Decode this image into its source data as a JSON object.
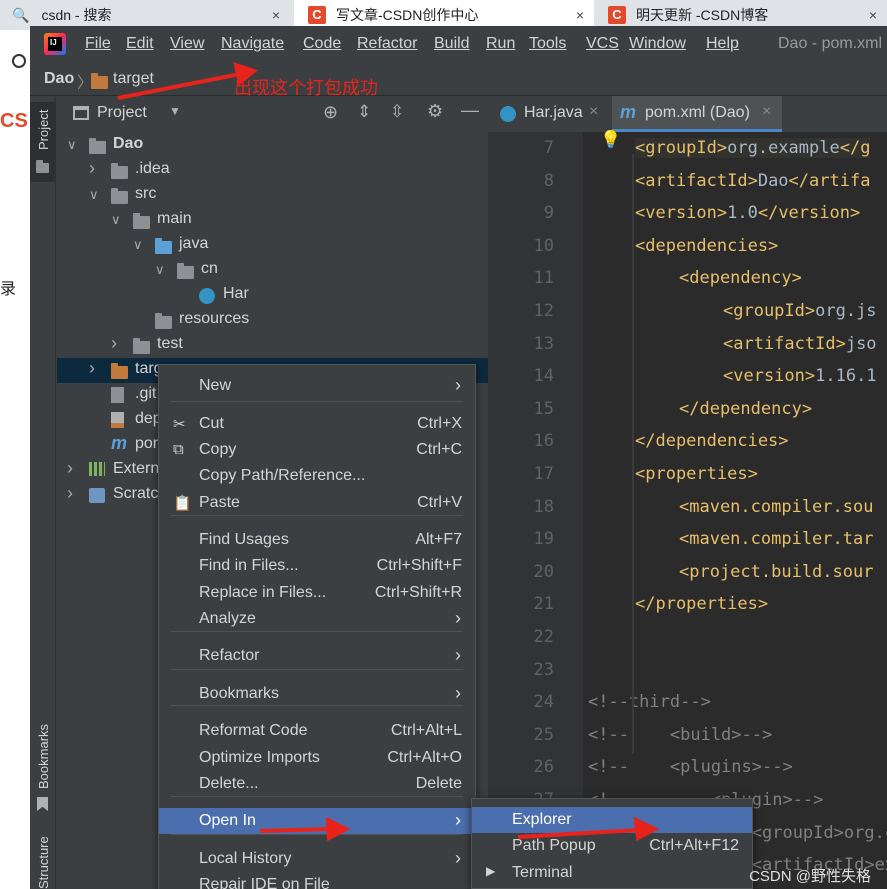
{
  "browser": {
    "tabs": [
      {
        "title": "csdn - 搜索",
        "close": "×"
      },
      {
        "title": "写文章-CSDN创作中心",
        "close": "×"
      },
      {
        "title": "明天更新 -CSDN博客",
        "close": "×"
      }
    ],
    "side_fragments": [
      "录",
      "CS"
    ]
  },
  "ide": {
    "menu": [
      "File",
      "Edit",
      "View",
      "Navigate",
      "Code",
      "Refactor",
      "Build",
      "Run",
      "Tools",
      "VCS",
      "Window",
      "Help"
    ],
    "window_title": "Dao - pom.xml",
    "breadcrumb": {
      "project": "Dao",
      "folder": "target"
    },
    "left_strip": {
      "project": "Project",
      "bookmarks": "Bookmarks",
      "structure": "Structure"
    },
    "project_panel": {
      "title": "Project"
    },
    "tree": [
      {
        "label": "Dao",
        "indent": 0,
        "chevron": "v",
        "icon": "folder-grey",
        "bold": true
      },
      {
        "label": ".idea",
        "indent": 1,
        "chevron": ">",
        "icon": "folder-grey"
      },
      {
        "label": "src",
        "indent": 1,
        "chevron": "v",
        "icon": "folder-grey"
      },
      {
        "label": "main",
        "indent": 2,
        "chevron": "v",
        "icon": "folder-grey"
      },
      {
        "label": "java",
        "indent": 3,
        "chevron": "v",
        "icon": "folder-blue"
      },
      {
        "label": "cn",
        "indent": 4,
        "chevron": "v",
        "icon": "package"
      },
      {
        "label": "Har",
        "indent": 5,
        "chevron": "",
        "icon": "class"
      },
      {
        "label": "resources",
        "indent": 3,
        "chevron": "",
        "icon": "folder-grey"
      },
      {
        "label": "test",
        "indent": 2,
        "chevron": ">",
        "icon": "folder-grey"
      },
      {
        "label": "targ",
        "indent": 1,
        "chevron": ">",
        "icon": "folder-brown",
        "selected": true
      },
      {
        "label": ".git",
        "indent": 1,
        "chevron": "",
        "icon": "file"
      },
      {
        "label": "dep",
        "indent": 1,
        "chevron": "",
        "icon": "xml"
      },
      {
        "label": "por",
        "indent": 1,
        "chevron": "",
        "icon": "maven"
      },
      {
        "label": "Externa",
        "indent": 0,
        "chevron": ">",
        "icon": "libraries"
      },
      {
        "label": "Scratch",
        "indent": 0,
        "chevron": ">",
        "icon": "scratch"
      }
    ],
    "editor_tabs": [
      {
        "label": "Har.java",
        "close": "×"
      },
      {
        "label": "pom.xml (Dao)",
        "close": "×",
        "active": true
      }
    ],
    "code_lines": [
      {
        "n": "7",
        "indent": 1,
        "parts": [
          [
            "tag",
            "<groupId>"
          ],
          [
            "txt",
            "org.example"
          ],
          [
            "tag",
            "</g"
          ]
        ]
      },
      {
        "n": "8",
        "indent": 1,
        "parts": [
          [
            "tag",
            "<artifactId>"
          ],
          [
            "txt",
            "Dao"
          ],
          [
            "tag",
            "</artifa"
          ]
        ]
      },
      {
        "n": "9",
        "indent": 1,
        "parts": [
          [
            "tag",
            "<version>"
          ],
          [
            "txt",
            "1.0"
          ],
          [
            "tag",
            "</version>"
          ]
        ]
      },
      {
        "n": "10",
        "indent": 1,
        "parts": [
          [
            "tag",
            "<dependencies>"
          ]
        ]
      },
      {
        "n": "11",
        "indent": 2,
        "parts": [
          [
            "tag",
            "<dependency>"
          ]
        ]
      },
      {
        "n": "12",
        "indent": 3,
        "parts": [
          [
            "tag",
            "<groupId>"
          ],
          [
            "txt",
            "org.js"
          ]
        ]
      },
      {
        "n": "13",
        "indent": 3,
        "parts": [
          [
            "tag",
            "<artifactId>"
          ],
          [
            "txt",
            "jso"
          ]
        ]
      },
      {
        "n": "14",
        "indent": 3,
        "parts": [
          [
            "tag",
            "<version>"
          ],
          [
            "txt",
            "1.16.1"
          ]
        ]
      },
      {
        "n": "15",
        "indent": 2,
        "parts": [
          [
            "tag",
            "</dependency>"
          ]
        ]
      },
      {
        "n": "16",
        "indent": 1,
        "parts": [
          [
            "tag",
            "</dependencies>"
          ]
        ]
      },
      {
        "n": "17",
        "indent": 1,
        "parts": [
          [
            "tag",
            "<properties>"
          ]
        ]
      },
      {
        "n": "18",
        "indent": 2,
        "parts": [
          [
            "tag",
            "<maven.compiler.sou"
          ]
        ]
      },
      {
        "n": "19",
        "indent": 2,
        "parts": [
          [
            "tag",
            "<maven.compiler.tar"
          ]
        ]
      },
      {
        "n": "20",
        "indent": 2,
        "parts": [
          [
            "tag",
            "<project.build.sour"
          ]
        ]
      },
      {
        "n": "21",
        "indent": 1,
        "parts": [
          [
            "tag",
            "</properties>"
          ]
        ]
      },
      {
        "n": "22",
        "indent": 0,
        "parts": []
      },
      {
        "n": "23",
        "indent": 0,
        "parts": []
      },
      {
        "n": "24",
        "indent": 0,
        "parts": [
          [
            "cm",
            "<!--third-->"
          ]
        ]
      },
      {
        "n": "25",
        "indent": 0,
        "parts": [
          [
            "cm",
            "<!--    <build>-->"
          ]
        ]
      },
      {
        "n": "26",
        "indent": 0,
        "parts": [
          [
            "cm",
            "<!--    <plugins>-->"
          ]
        ]
      },
      {
        "n": "27",
        "indent": 0,
        "parts": [
          [
            "cm",
            "<!--        <plugin>-->"
          ]
        ]
      },
      {
        "n": "28",
        "indent": 0,
        "parts": [
          [
            "cm",
            "<!--            <groupId>org.co"
          ]
        ]
      },
      {
        "n": "29",
        "indent": 0,
        "parts": [
          [
            "cm",
            "<!--            <artifactId>exe"
          ]
        ]
      }
    ],
    "context_menu": [
      {
        "label": "New",
        "submenu": true
      },
      {
        "sep": true
      },
      {
        "label": "Cut",
        "shortcut": "Ctrl+X",
        "icon": "✂"
      },
      {
        "label": "Copy",
        "shortcut": "Ctrl+C",
        "icon": "⧉"
      },
      {
        "label": "Copy Path/Reference...",
        "shortcut": ""
      },
      {
        "label": "Paste",
        "shortcut": "Ctrl+V",
        "icon": "📋"
      },
      {
        "sep": true
      },
      {
        "label": "Find Usages",
        "shortcut": "Alt+F7"
      },
      {
        "label": "Find in Files...",
        "shortcut": "Ctrl+Shift+F"
      },
      {
        "label": "Replace in Files...",
        "shortcut": "Ctrl+Shift+R"
      },
      {
        "label": "Analyze",
        "submenu": true
      },
      {
        "sep": true
      },
      {
        "label": "Refactor",
        "submenu": true
      },
      {
        "sep": true
      },
      {
        "label": "Bookmarks",
        "submenu": true
      },
      {
        "sep": true
      },
      {
        "label": "Reformat Code",
        "shortcut": "Ctrl+Alt+L"
      },
      {
        "label": "Optimize Imports",
        "shortcut": "Ctrl+Alt+O"
      },
      {
        "label": "Delete...",
        "shortcut": "Delete"
      },
      {
        "sep": true
      },
      {
        "label": "Open In",
        "submenu": true,
        "highlight": true
      },
      {
        "sep": true
      },
      {
        "label": "Local History",
        "submenu": true
      },
      {
        "label": "Repair IDE on File",
        "shortcut": ""
      }
    ],
    "open_in_submenu": [
      {
        "label": "Explorer",
        "shortcut": "",
        "highlight": true
      },
      {
        "label": "Path Popup",
        "shortcut": "Ctrl+Alt+F12"
      },
      {
        "label": "Terminal",
        "shortcut": "",
        "icon": "▶"
      }
    ]
  },
  "annotation": "出现这个打包成功",
  "watermark": "CSDN @野性失格",
  "colors": {
    "accent": "#4b6eaf",
    "annotation": "#e8231b",
    "tag": "#e8bf6a"
  }
}
